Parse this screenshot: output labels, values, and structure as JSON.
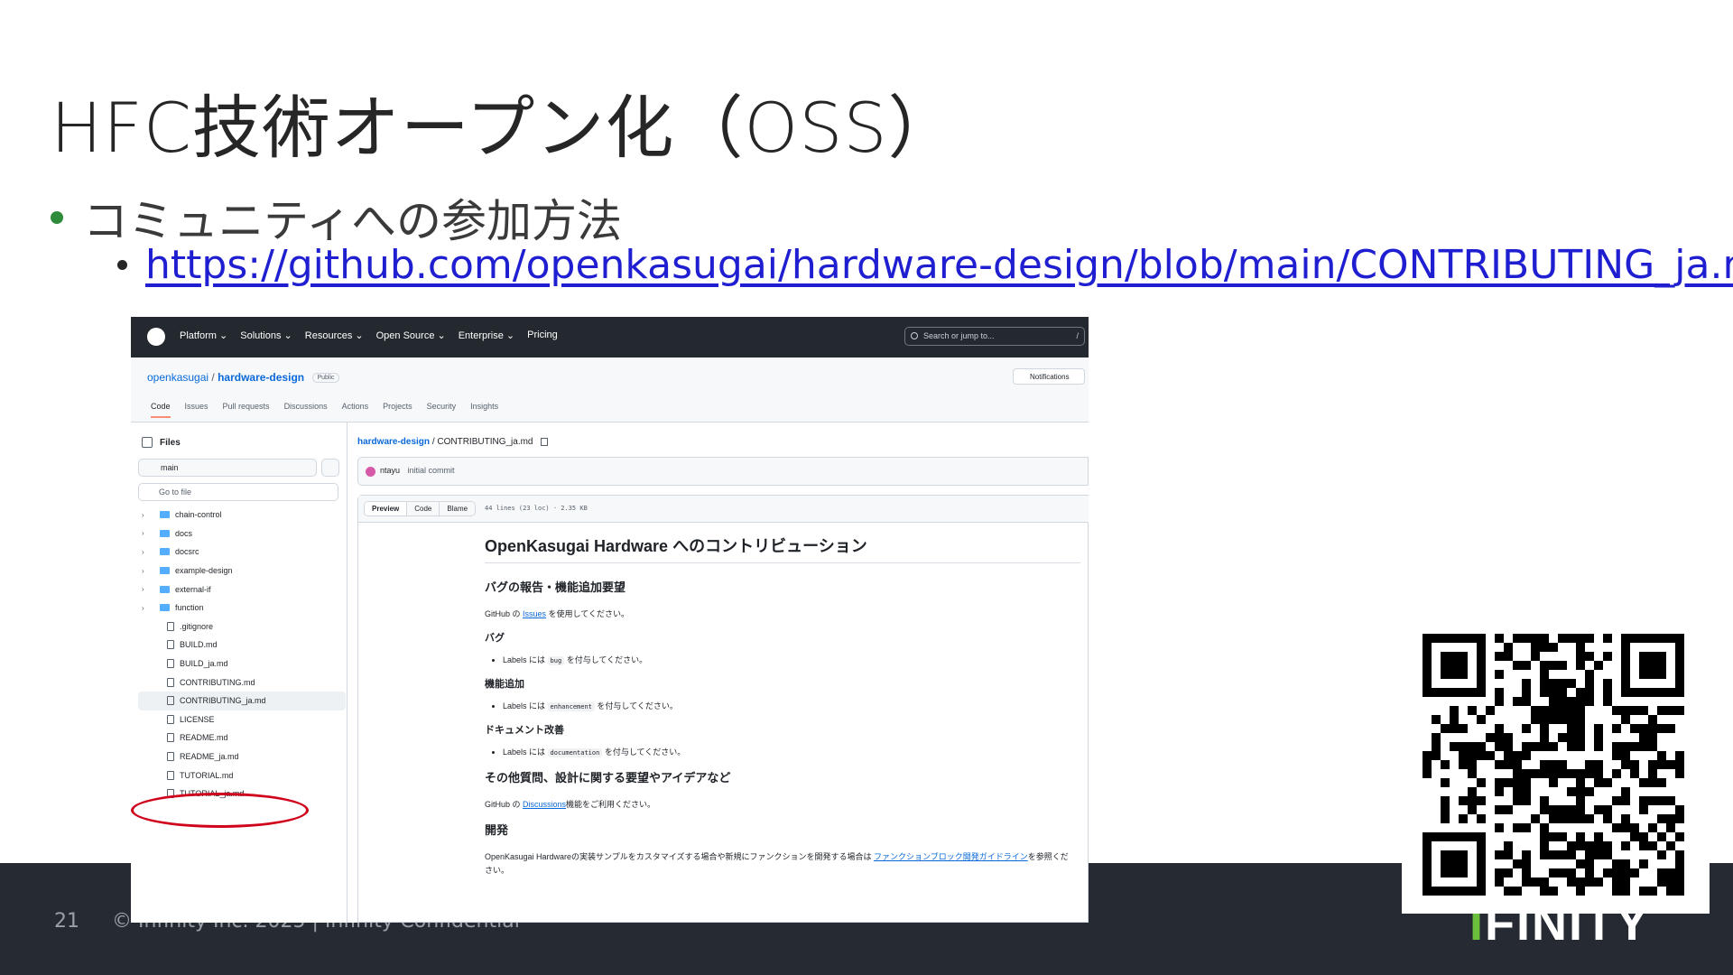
{
  "slide": {
    "title": "HFC技術オープン化（OSS）",
    "bullet1": "コミュニティへの参加方法",
    "link": "https://github.com/openkasugai/hardware-design/blob/main/CONTRIBUTING_ja.md"
  },
  "footer": {
    "page_number": "21",
    "copyright": "© Infinity Inc. 2025 | Infinity-Confidential",
    "logo_prefix": "I",
    "logo_rest": "FINITY",
    "background": "#262b33"
  },
  "github": {
    "nav": [
      "Platform ⌄",
      "Solutions ⌄",
      "Resources ⌄",
      "Open Source ⌄",
      "Enterprise ⌄",
      "Pricing"
    ],
    "search_placeholder": "Search or jump to...",
    "search_key": "/",
    "owner": "openkasugai",
    "separator": " / ",
    "repo": "hardware-design",
    "visibility": "Public",
    "notifications": "Notifications",
    "tabs": [
      "Code",
      "Issues",
      "Pull requests",
      "Discussions",
      "Actions",
      "Projects",
      "Security",
      "Insights"
    ],
    "files_title": "Files",
    "branch": "main",
    "goto_placeholder": "Go to file",
    "tree": [
      {
        "name": "chain-control",
        "type": "folder"
      },
      {
        "name": "docs",
        "type": "folder"
      },
      {
        "name": "docsrc",
        "type": "folder"
      },
      {
        "name": "example-design",
        "type": "folder"
      },
      {
        "name": "external-if",
        "type": "folder"
      },
      {
        "name": "function",
        "type": "folder"
      },
      {
        "name": ".gitignore",
        "type": "file"
      },
      {
        "name": "BUILD.md",
        "type": "file"
      },
      {
        "name": "BUILD_ja.md",
        "type": "file"
      },
      {
        "name": "CONTRIBUTING.md",
        "type": "file"
      },
      {
        "name": "CONTRIBUTING_ja.md",
        "type": "file",
        "selected": true
      },
      {
        "name": "LICENSE",
        "type": "file"
      },
      {
        "name": "README.md",
        "type": "file"
      },
      {
        "name": "README_ja.md",
        "type": "file"
      },
      {
        "name": "TUTORIAL.md",
        "type": "file"
      },
      {
        "name": "TUTORIAL_ja.md",
        "type": "file"
      }
    ],
    "breadcrumb_repo": "hardware-design",
    "breadcrumb_file": "CONTRIBUTING_ja.md",
    "commit_author": "ntayu",
    "commit_message": "initial commit",
    "view_tabs": [
      "Preview",
      "Code",
      "Blame"
    ],
    "file_meta": "44 lines (23 loc) · 2.35 KB",
    "doc": {
      "h1": "OpenKasugai Hardware へのコントリビューション",
      "h2_bug": "バグの報告・機能追加要望",
      "p_issues_pre": "GitHub の ",
      "p_issues_link": "Issues",
      "p_issues_post": " を使用してください。",
      "h3_bug": "バグ",
      "li_label_pre": "Labels には ",
      "li_bug_code": "bug",
      "li_label_post": " を付与してください。",
      "h3_feature": "機能追加",
      "li_enh_code": "enhancement",
      "h3_docs": "ドキュメント改善",
      "li_doc_code": "documentation",
      "h2_other": "その他質問、設計に関する要望やアイデアなど",
      "p_disc_pre": "GitHub の ",
      "p_disc_link": "Discussions",
      "p_disc_post": "機能をご利用ください。",
      "h2_dev": "開発",
      "p_dev_pre": "OpenKasugai Hardwareの実装サンプルをカスタマイズする場合や新規にファンクションを開発する場合は ",
      "p_dev_link": "ファンクションブロック開発ガイドライン",
      "p_dev_post": "を参照ください。"
    }
  },
  "colors": {
    "accent_green": "#2e8b3c",
    "link_blue": "#1f1fd1",
    "highlight_circle": "#d0021b",
    "logo_green": "#6cbf3c"
  }
}
